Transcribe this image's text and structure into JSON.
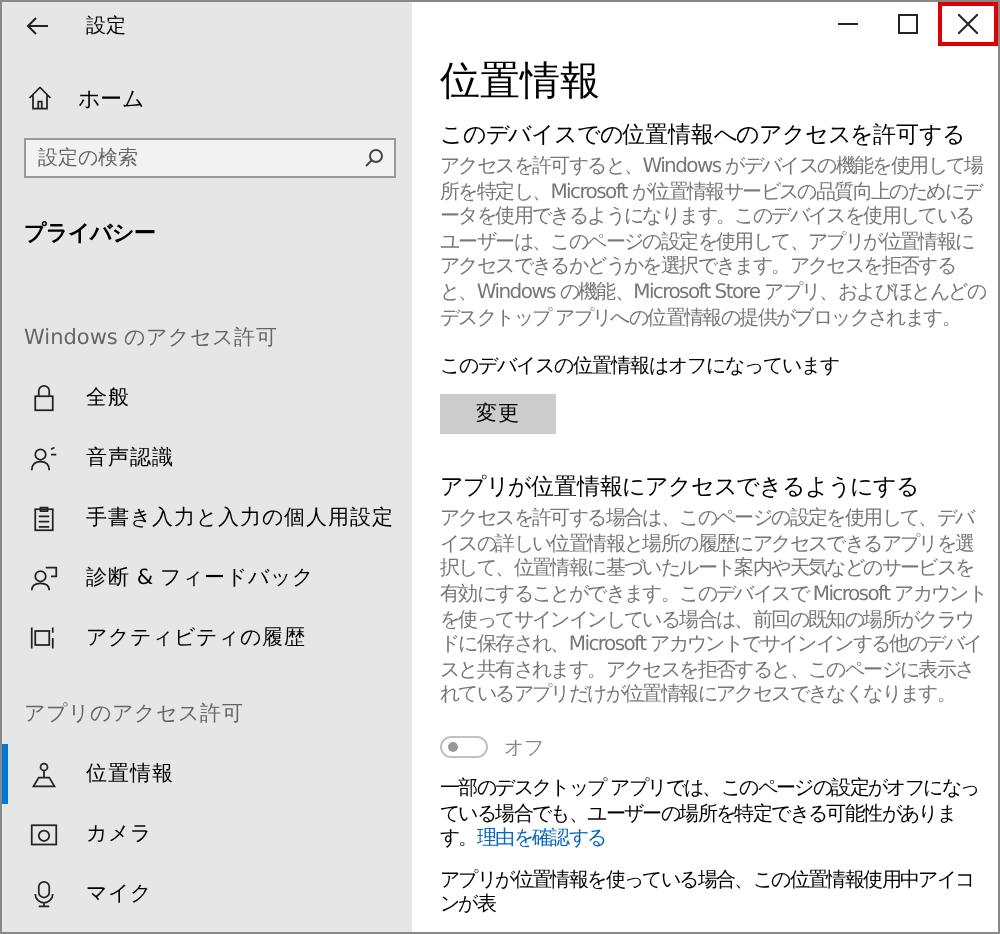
{
  "window": {
    "title": "設定",
    "red_highlight_on_close": true
  },
  "sidebar": {
    "home": "ホーム",
    "search": {
      "placeholder": "設定の検索"
    },
    "heading": "プライバシー",
    "groups": [
      {
        "title": "Windows のアクセス許可",
        "items": [
          {
            "label": "全般",
            "selected": false
          },
          {
            "label": "音声認識",
            "selected": false
          },
          {
            "label": "手書き入力と入力の個人用設定",
            "selected": false
          },
          {
            "label": "診断 & フィードバック",
            "selected": false
          },
          {
            "label": "アクティビティの履歴",
            "selected": false
          }
        ]
      },
      {
        "title": "アプリのアクセス許可",
        "items": [
          {
            "label": "位置情報",
            "selected": true
          },
          {
            "label": "カメラ",
            "selected": false
          },
          {
            "label": "マイク",
            "selected": false
          }
        ]
      }
    ]
  },
  "main": {
    "title": "位置情報",
    "section1": {
      "heading": "このデバイスでの位置情報へのアクセスを許可する",
      "body": "アクセスを許可すると、Windows がデバイスの機能を使用して場所を特定し、Microsoft が位置情報サービスの品質向上のためにデータを使用できるようになります。このデバイスを使用しているユーザーは、このページの設定を使用して、アプリが位置情報にアクセスできるかどうかを選択できます。アクセスを拒否すると、Windows の機能、Microsoft Store アプリ、およびほとんどのデスクトップ アプリへの位置情報の提供がブロックされます。",
      "status": "このデバイスの位置情報はオフになっています",
      "button": "変更"
    },
    "section2": {
      "heading": "アプリが位置情報にアクセスできるようにする",
      "body": "アクセスを許可する場合は、このページの設定を使用して、デバイスの詳しい位置情報と場所の履歴にアクセスできるアプリを選択して、位置情報に基づいたルート案内や天気などのサービスを有効にすることができます。このデバイスで Microsoft アカウントを使ってサインインしている場合は、前回の既知の場所がクラウドに保存され、Microsoft アカウントでサインインする他のデバイスと共有されます。アクセスを拒否すると、このページに表示されているアプリだけが位置情報にアクセスできなくなります。",
      "toggle": {
        "on": false,
        "disabled": true,
        "label": "オフ"
      },
      "note": "一部のデスクトップ アプリでは、このページの設定がオフになっている場合でも、ユーザーの場所を特定できる可能性があります。",
      "link": "理由を確認する",
      "footer": "アプリが位置情報を使っている場合、この位置情報使用中アイコンが表"
    }
  }
}
